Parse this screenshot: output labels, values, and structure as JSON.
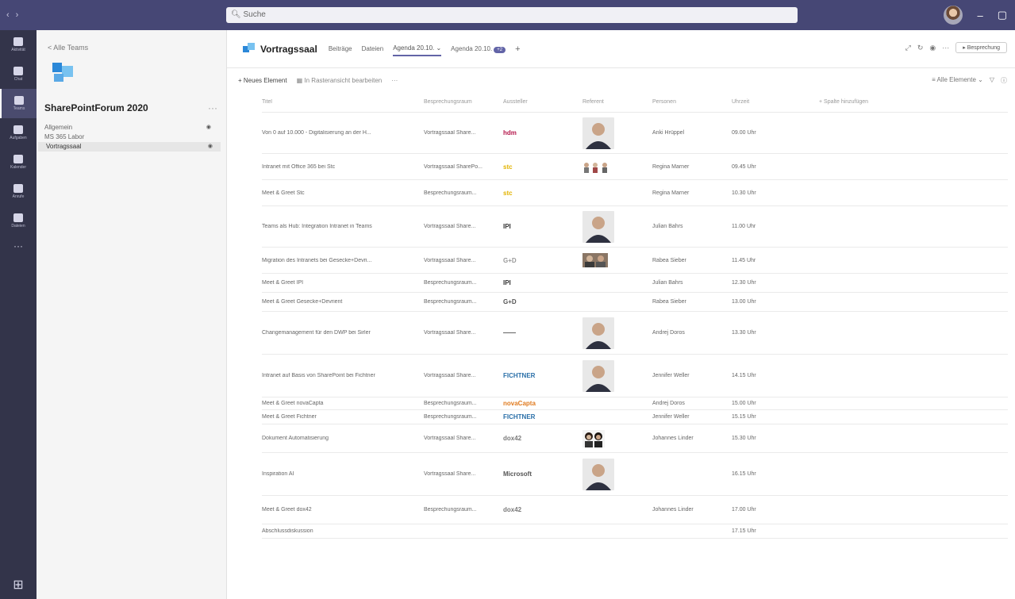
{
  "titlebar": {
    "search_placeholder": "Suche"
  },
  "rail": [
    {
      "label": "Aktivität",
      "icon": "bell-icon"
    },
    {
      "label": "Chat",
      "icon": "chat-icon"
    },
    {
      "label": "Teams",
      "icon": "teams-icon"
    },
    {
      "label": "Aufgaben",
      "icon": "briefcase-icon"
    },
    {
      "label": "Kalender",
      "icon": "calendar-icon"
    },
    {
      "label": "Anrufe",
      "icon": "phone-icon"
    },
    {
      "label": "Dateien",
      "icon": "file-icon"
    }
  ],
  "rail_more": "···",
  "leftpanel": {
    "back": "< Alle Teams",
    "team_name": "SharePointForum 2020",
    "team_more": "···",
    "channels": [
      "Allgemein",
      "MS 365 Labor",
      "Vortragssaal"
    ]
  },
  "channel": {
    "title": "Vortragssaal",
    "tabs": [
      "Beiträge",
      "Dateien",
      "Agenda 20.10.",
      "Agenda 20.10."
    ],
    "tab_badge": "+2",
    "tab_add": "+",
    "meet_button": "Besprechung"
  },
  "commandbar": {
    "new_item": "+ Neues Element",
    "grid_edit": "In Rasteransicht bearbeiten",
    "more": "···",
    "view": "Alle Elemente",
    "filter": "▽",
    "info": "ⓘ"
  },
  "table": {
    "headers": [
      "Titel",
      "Besprechungsraum",
      "Aussteller",
      "Referent",
      "Personen",
      "Uhrzeit",
      "+ Spalte hinzufügen"
    ],
    "rows": [
      {
        "title": "Von 0 auf 10.000 - Digitalisierung an der H...",
        "room": "Vortragssaal Share...",
        "exhibitor": "hdm",
        "exhibitor_color": "#b5174b",
        "photo": "single",
        "person": "Anki Hrüppel",
        "time": "09.00 Uhr",
        "h": 52
      },
      {
        "title": "Intranet mit Office 365 bei Stc",
        "room": "Vortragssaal SharePo...",
        "exhibitor": "stc",
        "exhibitor_color": "#e2b300",
        "photo": "small",
        "person": "Regina Marner",
        "time": "09.45 Uhr",
        "h": 33
      },
      {
        "title": "Meet & Greet Stc",
        "room": "Besprechungsraum...",
        "exhibitor": "stc",
        "exhibitor_color": "#e2b300",
        "photo": "",
        "person": "Regina Marner",
        "time": "10.30 Uhr",
        "h": 33
      },
      {
        "title": "Teams als Hub: Integration Intranet in Teams",
        "room": "Vortragssaal Share...",
        "exhibitor": "IPI",
        "exhibitor_color": "#333333",
        "photo": "single",
        "person": "Julian Bahrs",
        "time": "11.00 Uhr",
        "h": 52
      },
      {
        "title": "Migration des Intranets bei Gesecke+Devri...",
        "room": "Vortragssaal Share...",
        "exhibitor": "G+D",
        "exhibitor_color": "#999999",
        "photo": "double",
        "person": "Rabea Sieber",
        "time": "11.45 Uhr",
        "h": 33
      },
      {
        "title": "Meet & Greet IPI",
        "room": "Besprechungsraum...",
        "exhibitor": "IPI",
        "exhibitor_color": "#333333",
        "photo": "",
        "person": "Julian Bahrs",
        "time": "12.30 Uhr",
        "h": 24
      },
      {
        "title": "Meet & Greet Gesecke+Devrient",
        "room": "Besprechungsraum...",
        "exhibitor": "G+D",
        "exhibitor_color": "#555555",
        "photo": "",
        "person": "Rabea Sieber",
        "time": "13.00 Uhr",
        "h": 24
      },
      {
        "title": "Changemanagement für den DWP bei Sirler",
        "room": "Vortragssaal Share...",
        "exhibitor": "——",
        "exhibitor_color": "#444444",
        "photo": "single",
        "person": "Andrej Doros",
        "time": "13.30 Uhr",
        "h": 54
      },
      {
        "title": "Intranet auf Basis von SharePoint bei Fichtner",
        "room": "Vortragssaal Share...",
        "exhibitor": "FICHTNER",
        "exhibitor_color": "#2a6fa8",
        "photo": "single",
        "person": "Jennifer Weller",
        "time": "14.15 Uhr",
        "h": 54
      },
      {
        "title": "Meet & Greet novaCapta",
        "room": "Besprechungsraum...",
        "exhibitor": "novaCapta",
        "exhibitor_color": "#e07b1f",
        "photo": "",
        "person": "Andrej Doros",
        "time": "15.00 Uhr",
        "h": 16
      },
      {
        "title": "Meet & Greet Fichtner",
        "room": "Besprechungsraum...",
        "exhibitor": "FICHTNER",
        "exhibitor_color": "#2a6fa8",
        "photo": "",
        "person": "Jennifer Weller",
        "time": "15.15 Uhr",
        "h": 18
      },
      {
        "title": "Dokument Automatisierung",
        "room": "Vortragssaal Share...",
        "exhibitor": "dox42",
        "exhibitor_color": "#7a7a7a",
        "photo": "double-w",
        "person": "Johannes Linder",
        "time": "15.30 Uhr",
        "h": 36
      },
      {
        "title": "Inspiration AI",
        "room": "Vortragssaal Share...",
        "exhibitor": "Microsoft",
        "exhibitor_color": "#555555",
        "photo": "single",
        "person": "",
        "time": "16.15 Uhr",
        "h": 54
      },
      {
        "title": "Meet & Greet dox42",
        "room": "Besprechungsraum...",
        "exhibitor": "dox42",
        "exhibitor_color": "#7a7a7a",
        "photo": "",
        "person": "Johannes Linder",
        "time": "17.00 Uhr",
        "h": 36
      },
      {
        "title": "Abschlussdiskussion",
        "room": "",
        "exhibitor": "",
        "exhibitor_color": "#7a7a7a",
        "photo": "",
        "person": "",
        "time": "17.15 Uhr",
        "h": 18
      }
    ]
  }
}
